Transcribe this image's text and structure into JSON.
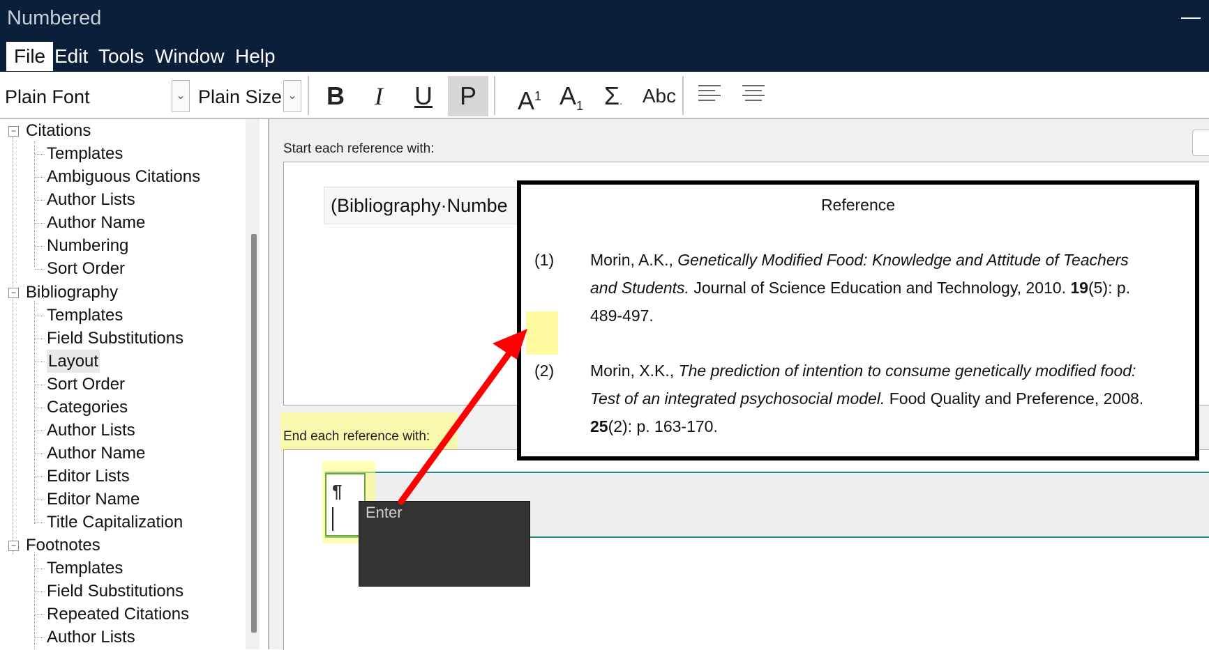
{
  "window": {
    "title": "Numbered",
    "minimize_glyph": "—"
  },
  "menu": {
    "items": [
      "File",
      "Edit",
      "Tools",
      "Window",
      "Help"
    ],
    "active": "File"
  },
  "toolbar": {
    "font": "Plain Font",
    "size": "Plain Size",
    "bold": "B",
    "italic": "I",
    "underline": "U",
    "plain": "P",
    "superscript": "A",
    "superscript_mark": "1",
    "subscript": "A",
    "subscript_mark": "1",
    "symbol": "Σ",
    "small_caps": "Abc"
  },
  "sidebar": {
    "groups": [
      {
        "label": "Citations",
        "items": [
          "Templates",
          "Ambiguous Citations",
          "Author Lists",
          "Author Name",
          "Numbering",
          "Sort Order"
        ]
      },
      {
        "label": "Bibliography",
        "items": [
          "Templates",
          "Field Substitutions",
          "Layout",
          "Sort Order",
          "Categories",
          "Author Lists",
          "Author Name",
          "Editor Lists",
          "Editor Name",
          "Title Capitalization"
        ]
      },
      {
        "label": "Footnotes",
        "items": [
          "Templates",
          "Field Substitutions",
          "Repeated Citations",
          "Author Lists"
        ]
      }
    ],
    "selected": "Layout"
  },
  "main": {
    "start_label": "Start each reference with:",
    "start_value": "(Bibliography·Numbe",
    "end_label": "End each reference with:",
    "end_mark": "¶"
  },
  "tooltip": {
    "text": "Enter"
  },
  "reference": {
    "title": "Reference",
    "entries": [
      {
        "num": "(1)",
        "l1_a": "Morin, A.K., ",
        "l1_b": "Genetically Modified Food: Knowledge and Attitude of Teachers",
        "l2_a": "and Students.",
        "l2_b": " Journal of Science Education and Technology, 2010. ",
        "l2_c": "19",
        "l2_d": "(5): p.",
        "l3": "489-497."
      },
      {
        "num": "(2)",
        "l1_a": "Morin, X.K., ",
        "l1_b": "The prediction of intention to consume genetically modified food:",
        "l2_a": "Test of an integrated psychosocial model.",
        "l2_b": " Food Quality and Preference, 2008.",
        "l3_a": "25",
        "l3_b": "(2): p. 163-170."
      }
    ]
  },
  "colors": {
    "titlebar": "#0c1f3a",
    "highlight": "#ffff78",
    "arrow": "#ff0000",
    "teal": "#1f8c85"
  }
}
